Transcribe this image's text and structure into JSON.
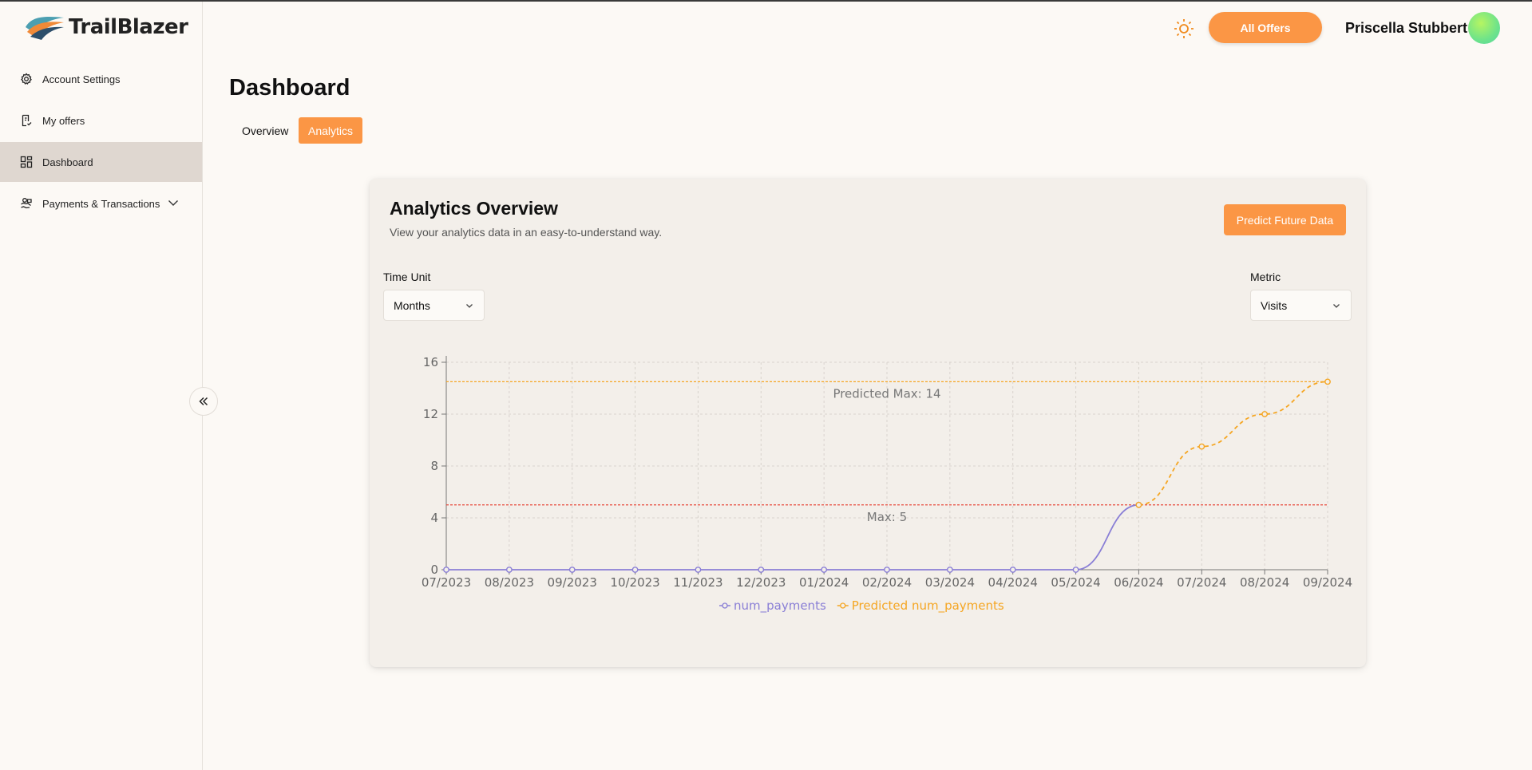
{
  "brand": {
    "name": "TrailBlazer"
  },
  "sidebar": {
    "items": [
      {
        "label": "Account Settings",
        "icon": "gear-icon"
      },
      {
        "label": "My offers",
        "icon": "document-icon"
      },
      {
        "label": "Dashboard",
        "icon": "grid-icon",
        "active": true
      },
      {
        "label": "Payments & Transactions",
        "icon": "payments-icon",
        "expandable": true
      }
    ]
  },
  "header": {
    "all_offers_label": "All Offers",
    "user_name": "Priscella Stubbert",
    "theme_icon": "sun-icon"
  },
  "main": {
    "title": "Dashboard",
    "tabs": [
      {
        "label": "Overview",
        "active": false
      },
      {
        "label": "Analytics",
        "active": true
      }
    ]
  },
  "card": {
    "title": "Analytics Overview",
    "subtitle": "View your analytics data in an easy-to-understand way.",
    "predict_label": "Predict Future Data",
    "time_unit": {
      "label": "Time Unit",
      "value": "Months"
    },
    "metric": {
      "label": "Metric",
      "value": "Visits"
    }
  },
  "colors": {
    "accent": "#fb9645",
    "actual": "#8a7fd6",
    "predicted": "#f5a623",
    "max_line": "#e8473b"
  },
  "chart_data": {
    "type": "line",
    "x": [
      "07/2023",
      "08/2023",
      "09/2023",
      "10/2023",
      "11/2023",
      "12/2023",
      "01/2024",
      "02/2024",
      "03/2024",
      "04/2024",
      "05/2024",
      "06/2024",
      "07/2024",
      "08/2024",
      "09/2024"
    ],
    "series": [
      {
        "name": "num_payments",
        "values": [
          0,
          0,
          0,
          0,
          0,
          0,
          0,
          0,
          0,
          0,
          0,
          5,
          null,
          null,
          null
        ]
      },
      {
        "name": "Predicted num_payments",
        "values": [
          null,
          null,
          null,
          null,
          null,
          null,
          null,
          null,
          null,
          null,
          null,
          5,
          9.5,
          12,
          14.5
        ],
        "dashed": true
      }
    ],
    "ylim": [
      0,
      16
    ],
    "yticks": [
      0,
      4,
      8,
      12,
      16
    ],
    "reference_lines": [
      {
        "label": "Max: 5",
        "value": 5
      },
      {
        "label": "Predicted Max: 14",
        "value": 14.5
      }
    ],
    "grid": true,
    "legend": "bottom"
  }
}
